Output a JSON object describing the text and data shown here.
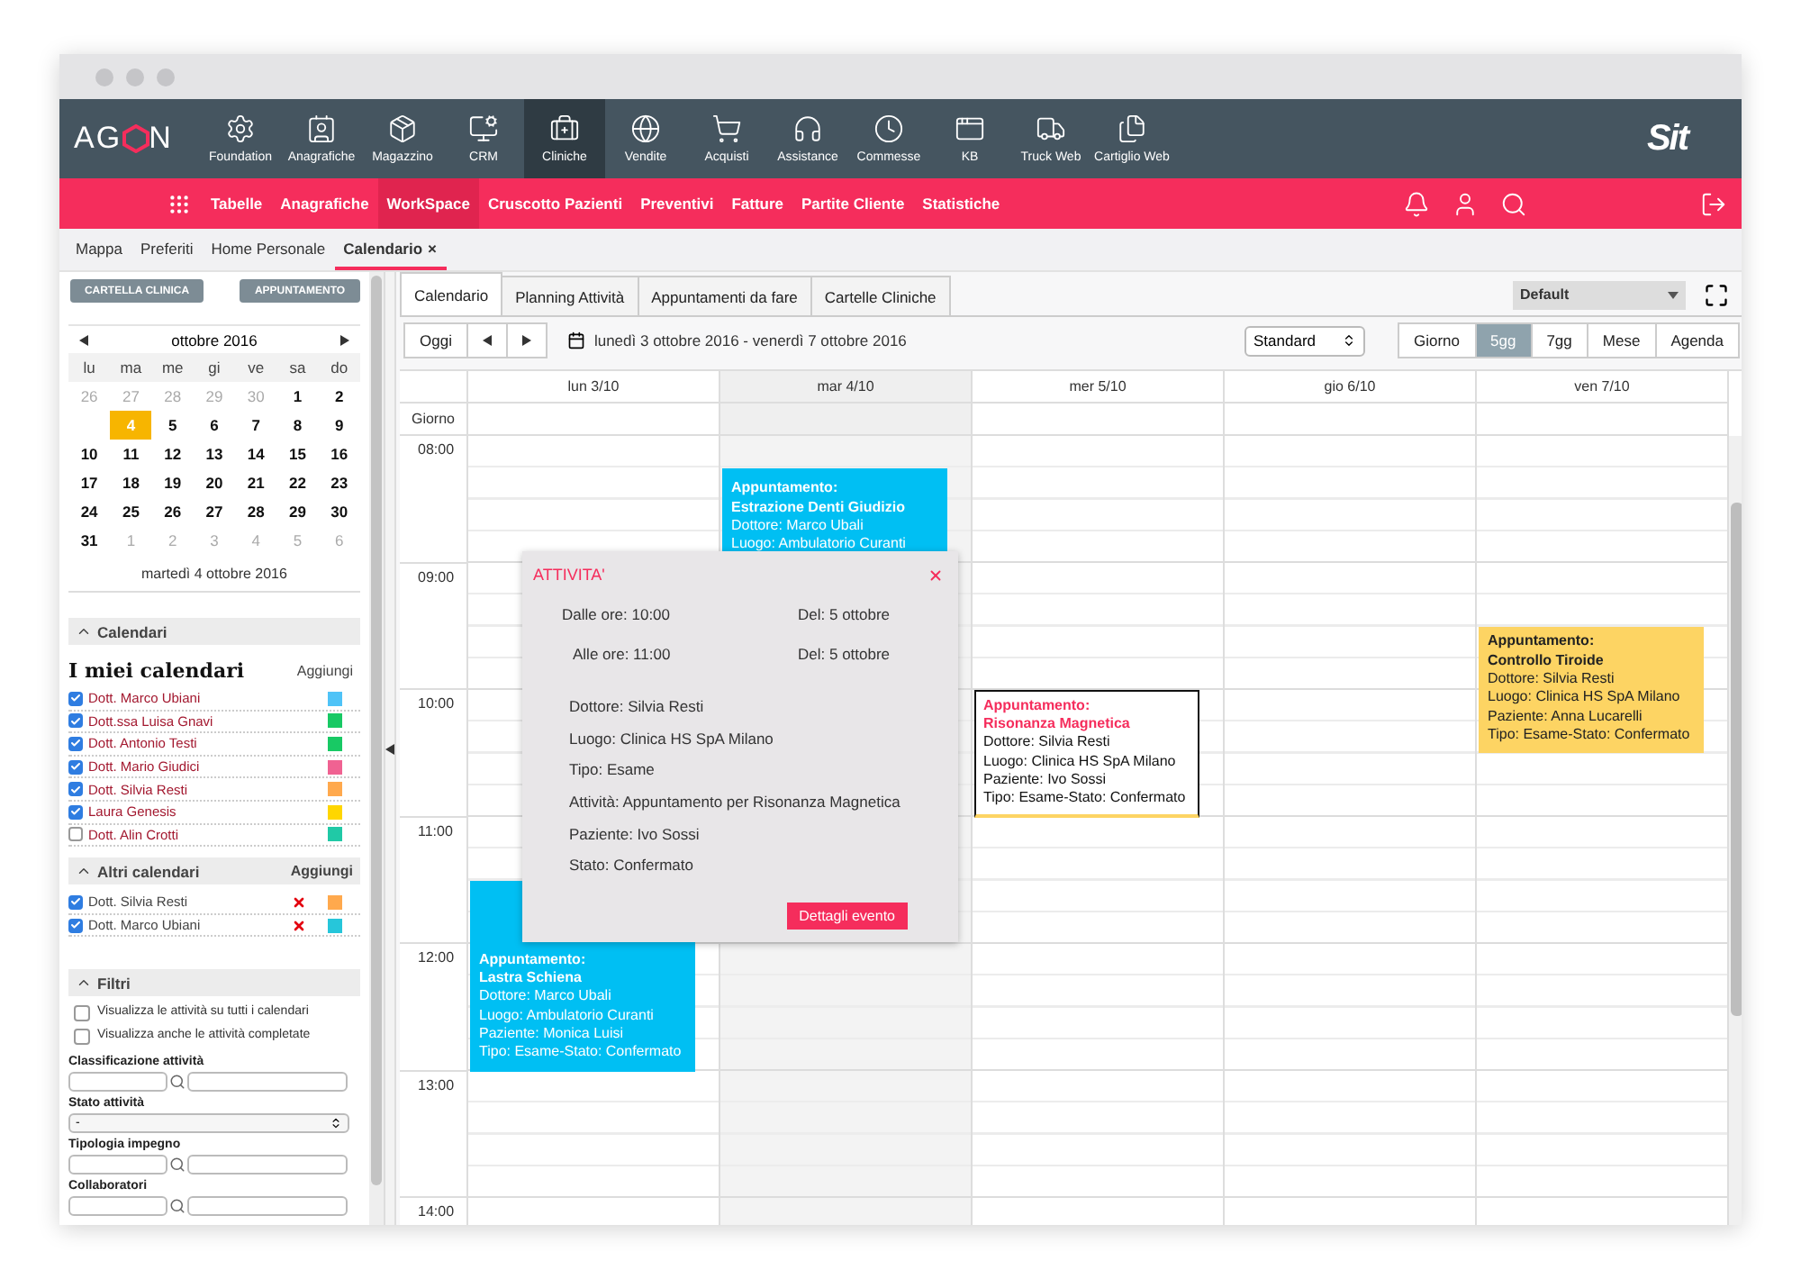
{
  "logo": {
    "before": "AG",
    "after": "N"
  },
  "brand": "Sit",
  "modules": [
    {
      "label": "Foundation",
      "selected": false
    },
    {
      "label": "Anagrafiche",
      "selected": false
    },
    {
      "label": "Magazzino",
      "selected": false
    },
    {
      "label": "CRM",
      "selected": false
    },
    {
      "label": "Cliniche",
      "selected": true
    },
    {
      "label": "Vendite",
      "selected": false
    },
    {
      "label": "Acquisti",
      "selected": false
    },
    {
      "label": "Assistance",
      "selected": false
    },
    {
      "label": "Commesse",
      "selected": false
    },
    {
      "label": "KB",
      "selected": false
    },
    {
      "label": "Truck Web",
      "selected": false
    },
    {
      "label": "Cartiglio Web",
      "selected": false
    }
  ],
  "menu": [
    {
      "label": "Tabelle",
      "selected": false
    },
    {
      "label": "Anagrafiche",
      "selected": false
    },
    {
      "label": "WorkSpace",
      "selected": true
    },
    {
      "label": "Cruscotto Pazienti",
      "selected": false
    },
    {
      "label": "Preventivi",
      "selected": false
    },
    {
      "label": "Fatture",
      "selected": false
    },
    {
      "label": "Partite Cliente",
      "selected": false
    },
    {
      "label": "Statistiche",
      "selected": false
    }
  ],
  "page_tabs": [
    {
      "label": "Mappa",
      "selected": false
    },
    {
      "label": "Preferiti",
      "selected": false
    },
    {
      "label": "Home Personale",
      "selected": false
    },
    {
      "label": "Calendario",
      "selected": true,
      "close": "×"
    }
  ],
  "sidebar": {
    "buttons": [
      "CARTELLA CLINICA",
      "APPUNTAMENTO"
    ],
    "mini_calendar": {
      "month": "ottobre 2016",
      "weekdays": [
        "lu",
        "ma",
        "me",
        "gi",
        "ve",
        "sa",
        "do"
      ],
      "weeks": [
        [
          {
            "day": "26",
            "muted": true,
            "selected": false
          },
          {
            "day": "27",
            "muted": true,
            "selected": false
          },
          {
            "day": "28",
            "muted": true,
            "selected": false
          },
          {
            "day": "29",
            "muted": true,
            "selected": false
          },
          {
            "day": "30",
            "muted": true,
            "selected": false
          },
          {
            "day": "1",
            "muted": false,
            "selected": false
          },
          {
            "day": "2",
            "muted": false,
            "selected": false
          }
        ],
        [
          {
            "day": "4",
            "muted": false,
            "selected": true
          },
          {
            "day": "5",
            "muted": false,
            "selected": false
          },
          {
            "day": "6",
            "muted": false,
            "selected": false
          },
          {
            "day": "7",
            "muted": false,
            "selected": false
          },
          {
            "day": "8",
            "muted": false,
            "selected": false
          },
          {
            "day": "9",
            "muted": false,
            "selected": false
          }
        ],
        [
          {
            "day": "10",
            "muted": false,
            "selected": false
          },
          {
            "day": "11",
            "muted": false,
            "selected": false
          },
          {
            "day": "12",
            "muted": false,
            "selected": false
          },
          {
            "day": "13",
            "muted": false,
            "selected": false
          },
          {
            "day": "14",
            "muted": false,
            "selected": false
          },
          {
            "day": "15",
            "muted": false,
            "selected": false
          },
          {
            "day": "16",
            "muted": false,
            "selected": false
          }
        ],
        [
          {
            "day": "17",
            "muted": false,
            "selected": false
          },
          {
            "day": "18",
            "muted": false,
            "selected": false
          },
          {
            "day": "19",
            "muted": false,
            "selected": false
          },
          {
            "day": "20",
            "muted": false,
            "selected": false
          },
          {
            "day": "21",
            "muted": false,
            "selected": false
          },
          {
            "day": "22",
            "muted": false,
            "selected": false
          },
          {
            "day": "23",
            "muted": false,
            "selected": false
          }
        ],
        [
          {
            "day": "24",
            "muted": false,
            "selected": false
          },
          {
            "day": "25",
            "muted": false,
            "selected": false
          },
          {
            "day": "26",
            "muted": false,
            "selected": false
          },
          {
            "day": "27",
            "muted": false,
            "selected": false
          },
          {
            "day": "28",
            "muted": false,
            "selected": false
          },
          {
            "day": "29",
            "muted": false,
            "selected": false
          },
          {
            "day": "30",
            "muted": false,
            "selected": false
          }
        ],
        [
          {
            "day": "31",
            "muted": false,
            "selected": false
          },
          {
            "day": "1",
            "muted": true,
            "selected": false
          },
          {
            "day": "2",
            "muted": true,
            "selected": false
          },
          {
            "day": "3",
            "muted": true,
            "selected": false
          },
          {
            "day": "4",
            "muted": true,
            "selected": false
          },
          {
            "day": "5",
            "muted": true,
            "selected": false
          },
          {
            "day": "6",
            "muted": true,
            "selected": false
          }
        ]
      ],
      "date_label": "martedì 4 ottobre 2016"
    },
    "calendars_section": {
      "title": "Calendari",
      "expanded": true
    },
    "my_calendars": {
      "title": "I miei calendari",
      "add": "Aggiungi",
      "items": [
        {
          "name": "Dott. Marco Ubiani",
          "checked": true,
          "color": "#4fc3f7"
        },
        {
          "name": "Dott.ssa Luisa Gnavi",
          "checked": true,
          "color": "#18c964"
        },
        {
          "name": "Dott. Antonio Testi",
          "checked": true,
          "color": "#18c964"
        },
        {
          "name": "Dott. Mario Giudici",
          "checked": true,
          "color": "#f06292"
        },
        {
          "name": "Dott. Silvia Resti",
          "checked": true,
          "color": "#ffa94d"
        },
        {
          "name": "Laura Genesis",
          "checked": true,
          "color": "#ffd600"
        },
        {
          "name": "Dott. Alin Crotti",
          "checked": false,
          "color": "#20c9a6"
        }
      ]
    },
    "other_calendars": {
      "title": "Altri calendari",
      "add": "Aggiungi",
      "expanded": true,
      "items": [
        {
          "name": "Dott. Silvia Resti",
          "checked": true,
          "color": "#ffa94d"
        },
        {
          "name": "Dott. Marco Ubiani",
          "checked": true,
          "color": "#26c6da"
        }
      ]
    },
    "filters": {
      "title": "Filtri",
      "expanded": true,
      "checkboxes": [
        {
          "label": "Visualizza le attività su tutti i calendari",
          "checked": false
        },
        {
          "label": "Visualizza anche le attività completate",
          "checked": false
        }
      ],
      "fields": [
        {
          "label": "Classificazione attività",
          "kind": "lookup"
        },
        {
          "label": "Stato attività",
          "kind": "select",
          "value": "-"
        },
        {
          "label": "Tipologia impegno",
          "kind": "lookup"
        },
        {
          "label": "Collaboratori",
          "kind": "lookup"
        }
      ]
    }
  },
  "calendar": {
    "tabs": [
      {
        "label": "Calendario",
        "selected": true
      },
      {
        "label": "Planning Attività",
        "selected": false
      },
      {
        "label": "Appuntamenti da fare",
        "selected": false
      },
      {
        "label": "Cartelle Cliniche",
        "selected": false
      }
    ],
    "profile": "Default",
    "today": "Oggi",
    "range": "lunedì 3 ottobre 2016 - venerdì 7 ottobre 2016",
    "mode": "Standard",
    "views": [
      {
        "label": "Giorno",
        "selected": false
      },
      {
        "label": "5gg",
        "selected": true
      },
      {
        "label": "7gg",
        "selected": false
      },
      {
        "label": "Mese",
        "selected": false
      },
      {
        "label": "Agenda",
        "selected": false
      }
    ],
    "days": [
      {
        "label": "lun 3/10",
        "today": false
      },
      {
        "label": "mar 4/10",
        "today": true
      },
      {
        "label": "mer 5/10",
        "today": false
      },
      {
        "label": "gio 6/10",
        "today": false
      },
      {
        "label": "ven 7/10",
        "today": false
      }
    ],
    "allday": "Giorno",
    "hours": [
      "08:00",
      "09:00",
      "10:00",
      "11:00",
      "12:00",
      "13:00",
      "14:00"
    ],
    "events": [
      {
        "color": "#00bff3",
        "selected": false,
        "title_label": "Appuntamento:",
        "title": "Estrazione Denti Giudizio",
        "lines": [
          "Dottore: Marco Ubali",
          "Luogo: Ambulatorio Curanti"
        ]
      },
      {
        "color": "#00bff3",
        "selected": false,
        "title_label": "Appuntamento:",
        "title": "Lastra Schiena",
        "lines": [
          "Dottore: Marco Ubali",
          "Luogo: Ambulatorio Curanti",
          "Paziente: Monica Luisi",
          "Tipo: Esame-Stato: Confermato"
        ]
      },
      {
        "color": "#fdd463",
        "selected": true,
        "title_label": "Appuntamento:",
        "title": "Risonanza Magnetica",
        "lines": [
          "Dottore: Silvia Resti",
          "Luogo: Clinica HS SpA Milano",
          "Paziente: Ivo Sossi",
          "Tipo: Esame-Stato: Confermato"
        ]
      },
      {
        "color": "#fdd463",
        "selected": false,
        "title_label": "Appuntamento:",
        "title": "Controllo Tiroide",
        "lines": [
          "Dottore: Silvia Resti",
          "Luogo: Clinica HS SpA Milano",
          "Paziente: Anna Lucarelli",
          "Tipo: Esame-Stato: Confermato"
        ]
      }
    ],
    "popup": {
      "title": "ATTIVITA'",
      "times": [
        [
          "Dalle ore: 10:00",
          "Del: 5 ottobre"
        ],
        [
          "Alle ore: 11:00",
          "Del: 5 ottobre"
        ]
      ],
      "details": [
        "Dottore: Silvia Resti",
        "Luogo: Clinica HS SpA Milano",
        "Tipo: Esame",
        "Attività: Appuntamento per Risonanza Magnetica",
        "Paziente: Ivo Sossi",
        "Stato: Confermato"
      ],
      "button": "Dettagli evento"
    }
  }
}
